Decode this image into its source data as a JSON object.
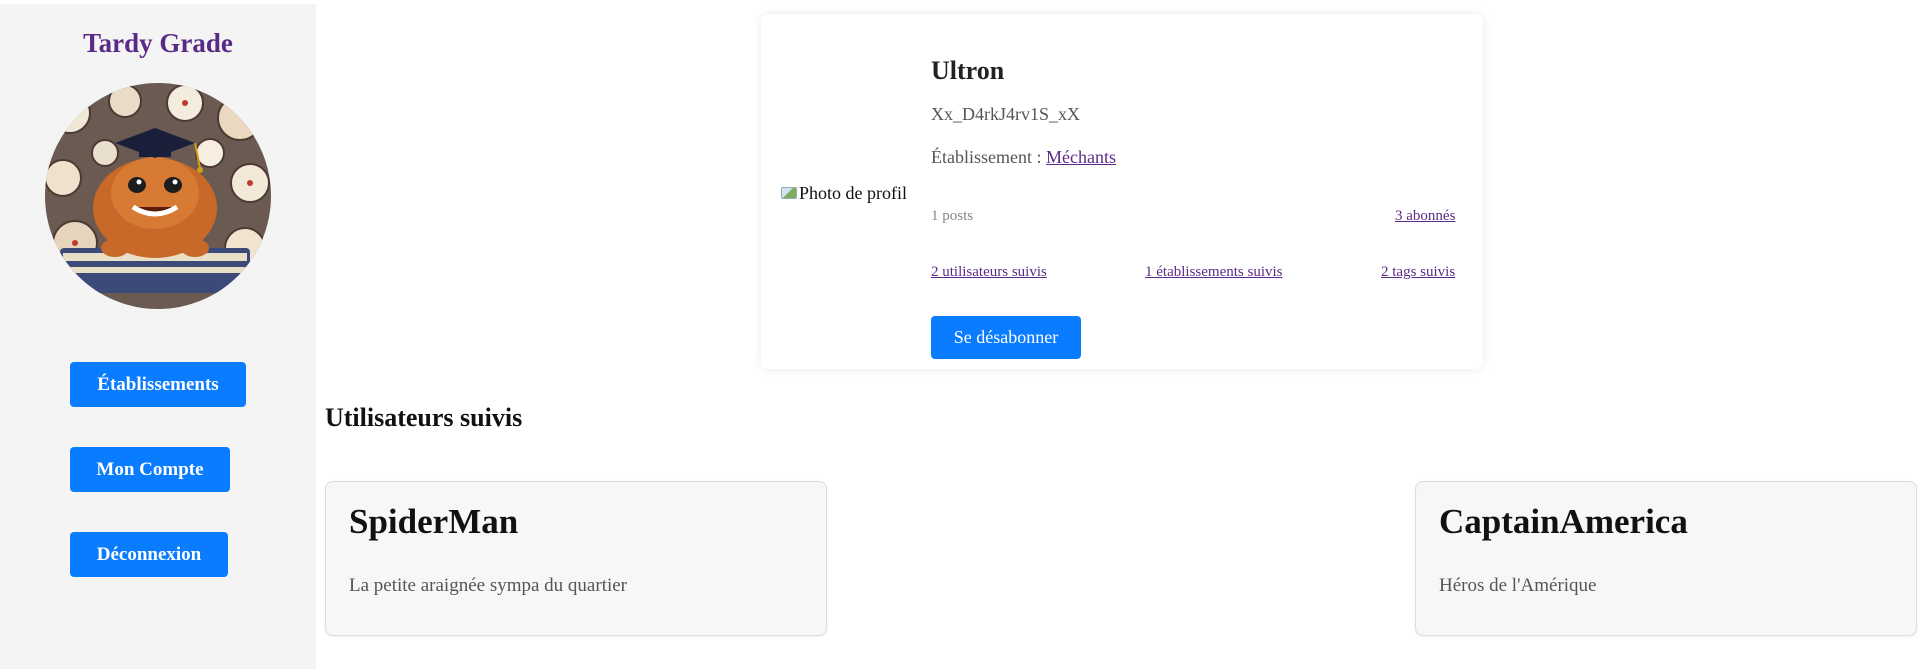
{
  "sidebar": {
    "brand": "Tardy Grade",
    "nav": [
      {
        "label": "Établissements"
      },
      {
        "label": "Mon Compte"
      },
      {
        "label": "Déconnexion"
      }
    ]
  },
  "profile": {
    "image_alt": "Photo de profil",
    "name": "Ultron",
    "handle": "Xx_D4rkJ4rv1S_xX",
    "etablissement_label": "Établissement : ",
    "etablissement_link": "Méchants",
    "posts": "1 posts",
    "followers": "3 abonnés",
    "following_users": "2 utilisateurs suivis",
    "following_etablissements": "1 établissements suivis",
    "following_tags": "2 tags suivis",
    "unsubscribe_label": "Se désabonner"
  },
  "followed": {
    "title": "Utilisateurs suivis",
    "users": [
      {
        "name": "SpiderMan",
        "description": "La petite araignée sympa du quartier"
      },
      {
        "name": "CaptainAmerica",
        "description": "Héros de l'Amérique"
      }
    ]
  },
  "colors": {
    "accent": "#0a7cff",
    "brand": "#5b2a86",
    "sidebar_bg": "#f4f4f4"
  }
}
